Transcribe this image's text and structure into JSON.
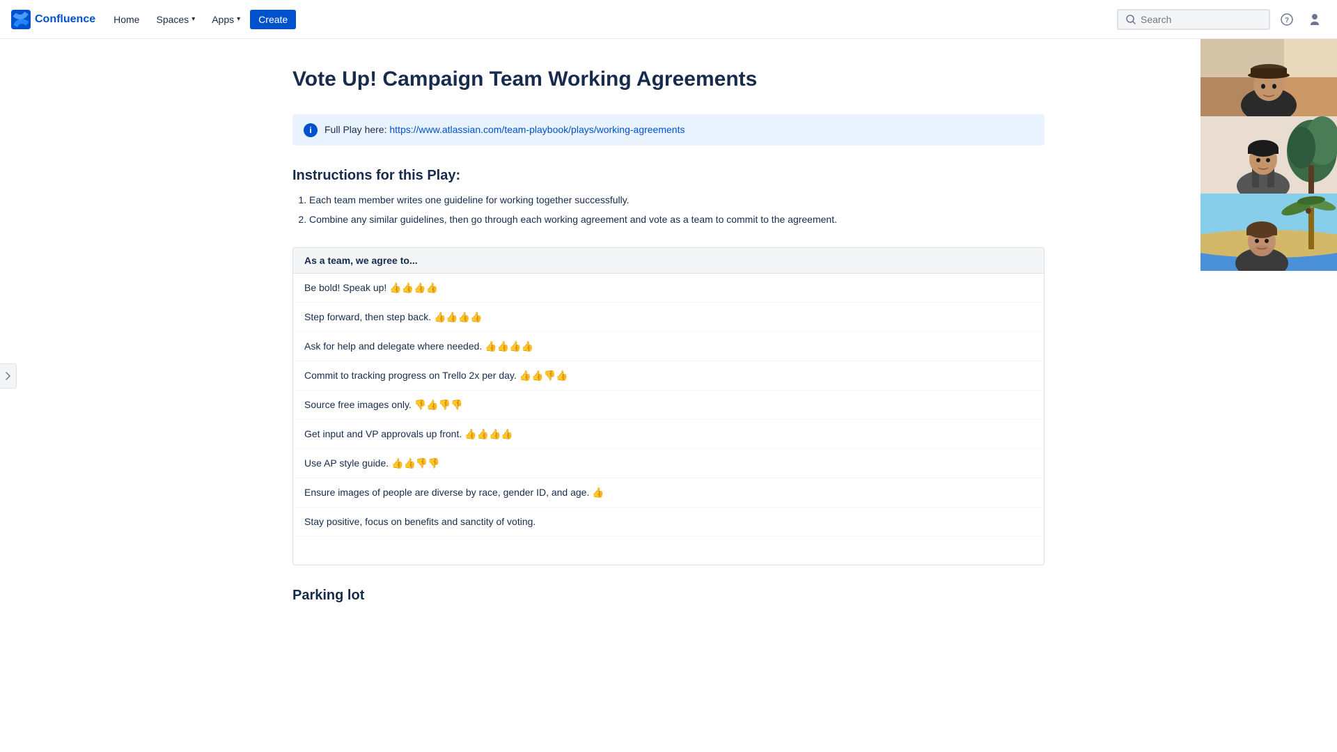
{
  "nav": {
    "logo_text": "Confluence",
    "home": "Home",
    "spaces": "Spaces",
    "apps": "Apps",
    "create": "Create",
    "search_placeholder": "Search"
  },
  "page": {
    "title": "Vote Up! Campaign Team Working Agreements",
    "info_banner": {
      "prefix": "Full Play here: ",
      "link_text": "https://www.atlassian.com/team-playbook/plays",
      "link_suffix": "/working-agreements"
    },
    "instructions_title": "Instructions for this Play:",
    "instructions": [
      "Each team member writes one guideline for working together successfully.",
      "Combine any similar guidelines, then go through each working agreement and vote as a team to commit to the agreement."
    ],
    "agreements_header": "As a team, we agree to...",
    "agreements": [
      "Be bold! Speak up! 👍👍👍👍",
      "Step forward, then step back. 👍👍👍👍",
      "Ask for help and delegate where needed. 👍👍👍👍",
      "Commit to tracking progress on Trello 2x per day. 👍👍👎👍",
      "Source free images only. 👎👍👎👎",
      "Get input and VP approvals up front. 👍👍👍👍",
      "Use AP style guide. 👍👍👎👎",
      "Ensure images of people are diverse by race, gender ID, and age. 👍",
      "Stay positive, focus on benefits and sanctity of voting."
    ],
    "parking_lot_title": "Parking lot"
  }
}
